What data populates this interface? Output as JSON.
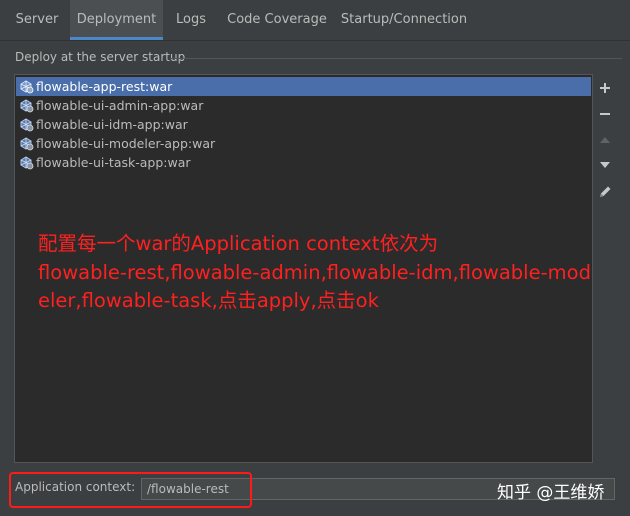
{
  "tabs": [
    {
      "label": "Server"
    },
    {
      "label": "Deployment"
    },
    {
      "label": "Logs"
    },
    {
      "label": "Code Coverage"
    },
    {
      "label": "Startup/Connection"
    }
  ],
  "active_tab": "Deployment",
  "deploy": {
    "title": "Deploy at the server startup",
    "items": [
      {
        "label": "flowable-app-rest:war",
        "selected": true
      },
      {
        "label": "flowable-ui-admin-app:war"
      },
      {
        "label": "flowable-ui-idm-app:war"
      },
      {
        "label": "flowable-ui-modeler-app:war"
      },
      {
        "label": "flowable-ui-task-app:war"
      }
    ]
  },
  "toolbar": {
    "add_icon": "plus-icon",
    "remove_icon": "minus-icon",
    "up_icon": "move-up-icon",
    "down_icon": "move-down-icon",
    "edit_icon": "pencil-icon"
  },
  "annotation": {
    "lines": [
      "配置每一个war的Application context依次为",
      "flowable-rest,flowable-admin,flowable-idm,flowable-mod",
      "eler,flowable-task,点击apply,点击ok"
    ],
    "color": "#ff2020"
  },
  "context": {
    "label": "Application context:",
    "value": "/flowable-rest"
  },
  "watermark": "知乎 @王维娇",
  "colors": {
    "selection": "#4a6ea9",
    "tab_underline": "#4a88c7",
    "highlight_box": "#ff1a1a"
  }
}
